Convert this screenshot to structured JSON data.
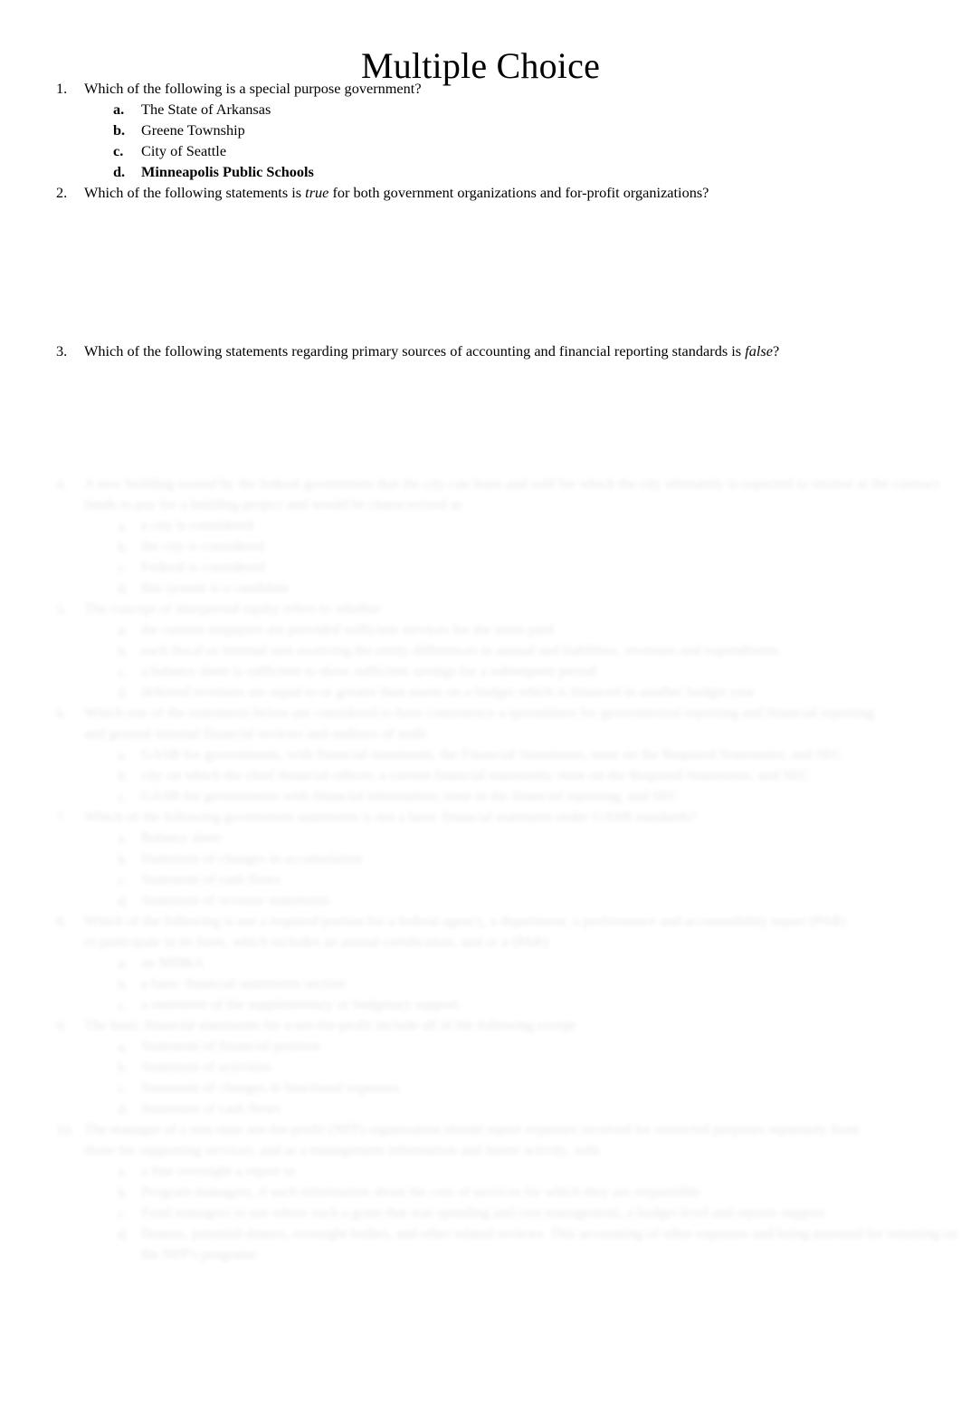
{
  "document": {
    "title": "Multiple Choice"
  },
  "questions": [
    {
      "number": "1.",
      "text": "Which of the following is a special purpose government?",
      "options": [
        {
          "letter": "a.",
          "text": "The State of Arkansas",
          "bold": false
        },
        {
          "letter": "b.",
          "text": "Greene Township",
          "bold": false
        },
        {
          "letter": "c.",
          "text": "City of Seattle",
          "bold": false
        },
        {
          "letter": "d.",
          "text": "Minneapolis Public Schools",
          "bold": true
        }
      ]
    },
    {
      "number": "2.",
      "text_before": "Which of the following statements is ",
      "emphasis": "true",
      "text_after": " for both government organizations and for-profit organizations?",
      "options": []
    },
    {
      "number": "3.",
      "text_before": "Which of the following statements regarding primary sources of accounting and financial reporting standards is ",
      "emphasis": "false",
      "text_after": "?",
      "options": []
    }
  ],
  "faded": {
    "note": "lower portion of page rendered at very low contrast / blurred; text not legible",
    "items": [
      {
        "number": "4.",
        "line1": "A new building owned by the federal government that the city can lease and sold for which the city ultimately is expected to receive at the contract",
        "line2": "funds to pay for a building project and would be characterized as",
        "options": [
          {
            "letter": "a.",
            "text": "a city is considered"
          },
          {
            "letter": "b.",
            "text": "the city is considered"
          },
          {
            "letter": "c.",
            "text": "Federal is considered"
          },
          {
            "letter": "d.",
            "text": "this system is a candidate"
          }
        ]
      },
      {
        "number": "5.",
        "line1": "The concept of interperiod equity refers to whether",
        "options": [
          {
            "letter": "a.",
            "text": "the current taxpayers are provided sufficient services for the taxes paid"
          },
          {
            "letter": "b.",
            "text": "each fiscal or internal unit receiving the entity differences in annual and liabilities, revenues and expenditures"
          },
          {
            "letter": "c.",
            "text": "a balance sheet is sufficient to show sufficient savings for a subsequent period"
          },
          {
            "letter": "d.",
            "text": "deferred revenues are equal to or greater than assets on a budget which is financed in another budget year"
          }
        ]
      },
      {
        "number": "6.",
        "line1": "Which one of the statements below are considered to have consistency a spreadsheet for governmental reporting and financial reporting",
        "line2": "and general internal financial reviews and auditors of audit",
        "options": [
          {
            "letter": "a.",
            "text": "GASB for governments, with financial statements; the Financial Statements; none on the Required Statements; and SEC"
          },
          {
            "letter": "b.",
            "text": "city on which the chief financial officer; a current financial statements; none on the Required Statements; and SEC"
          },
          {
            "letter": "c.",
            "text": "GASB for governments with financial information; none in the financial reporting; and SEC"
          }
        ]
      },
      {
        "number": "7.",
        "line1": "Which of the following government statements is not a basic financial statement under GASB standards?",
        "options": [
          {
            "letter": "a.",
            "text": "Balance sheet"
          },
          {
            "letter": "b.",
            "text": "Statement of changes in accumulation"
          },
          {
            "letter": "c.",
            "text": "Statement of cash flows"
          },
          {
            "letter": "d.",
            "text": "Statement of revenue statements"
          }
        ]
      },
      {
        "number": "8.",
        "line1": "Which of the following is not a required portion for a federal agency, a department, a performance and accountability report (PAR)",
        "line2": "to participate in its form, which includes an annual certification, and or a (PAR)",
        "options": [
          {
            "letter": "a.",
            "text": "an MD&A"
          },
          {
            "letter": "b.",
            "text": "a basic financial statements section"
          },
          {
            "letter": "c.",
            "text": "a statement of the supplementary or budgetary support"
          }
        ]
      },
      {
        "number": "9.",
        "line1": "The basic financial statements for a not-for-profit include all of the following except",
        "options": [
          {
            "letter": "a.",
            "text": "Statement of financial position"
          },
          {
            "letter": "b.",
            "text": "Statement of activities"
          },
          {
            "letter": "c.",
            "text": "Statement of changes in functional expenses"
          },
          {
            "letter": "d.",
            "text": "Statement of cash flows"
          }
        ]
      },
      {
        "number": "10.",
        "line1": "The manager of a non-state not-for-profit (NFP) organization should report expenses received for restricted purposes separately from",
        "line2": "those for supporting services; and as a management information and future activity, with",
        "options": [
          {
            "letter": "a.",
            "text": "a fine oversight a report to"
          },
          {
            "letter": "b.",
            "text": "Program managers, if such information about the cost of services for which they are responsible"
          },
          {
            "letter": "c.",
            "text": "Fund managers to use where such a grant that was spending and cost management, a budget level and reports support"
          },
          {
            "letter": "d.",
            "text": "Donors, potential donors, oversight bodies, and other related reviews. This accounting of other expenses and being assessed for returning on the NFP's programs"
          }
        ]
      }
    ]
  }
}
